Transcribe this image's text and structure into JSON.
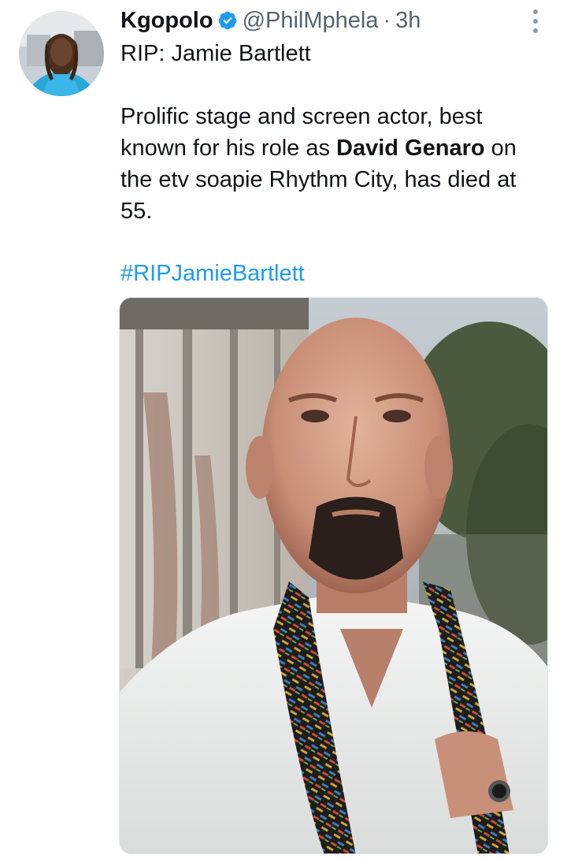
{
  "author": {
    "name": "Kgopolo",
    "handle": "@PhilMphela",
    "separator": "·",
    "time": "3h",
    "verified": true,
    "avatar_icon": "profile-photo"
  },
  "tweet": {
    "line1": "RIP: Jamie Bartlett",
    "para_before": "Prolific stage and screen actor, best known for his role as ",
    "para_bold": "David Genaro",
    "para_after": " on the etv soapie Rhythm City,  has died at 55.",
    "hashtag": "#RIPJamieBartlett"
  },
  "media": {
    "type": "photo",
    "subject": "bald-man-portrait"
  },
  "colors": {
    "link": "#1d9bf0",
    "secondary_text": "#536471",
    "verified_badge": "#1d9bf0"
  }
}
